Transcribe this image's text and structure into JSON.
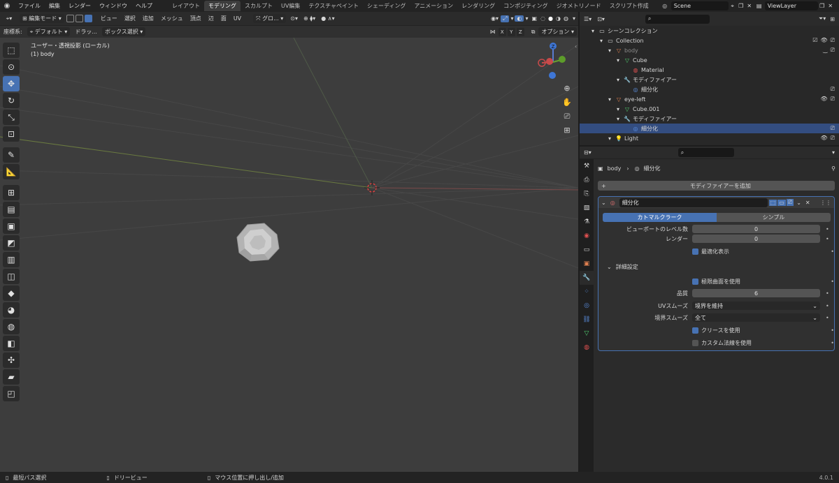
{
  "topbar": {
    "menus": [
      "ファイル",
      "編集",
      "レンダー",
      "ウィンドウ",
      "ヘルプ"
    ],
    "workspaces": [
      "レイアウト",
      "モデリング",
      "スカルプト",
      "UV編集",
      "テクスチャペイント",
      "シェーディング",
      "アニメーション",
      "レンダリング",
      "コンポジティング",
      "ジオメトリノード",
      "スクリプト作成"
    ],
    "active_workspace": "モデリング",
    "scene": "Scene",
    "view_layer": "ViewLayer"
  },
  "viewport_header": {
    "mode": "編集モード",
    "menus": [
      "ビュー",
      "選択",
      "追加",
      "メッシュ",
      "頂点",
      "辺",
      "面",
      "UV"
    ],
    "orientation": "グロ..."
  },
  "viewport_header2": {
    "coord_label": "座標系:",
    "coord_value": "デフォルト",
    "drag_label": "ドラッ...",
    "select_mode": "ボックス選択",
    "options": "オプション",
    "axes": [
      "X",
      "Y",
      "Z"
    ]
  },
  "viewport": {
    "view_name": "ユーザー・透視投影 (ローカル)",
    "object_name": "(1) body",
    "gizmo_z": "Z"
  },
  "outliner": {
    "rows": [
      {
        "label": "シーンコレクション",
        "indent": 0,
        "icon": "collection-icon"
      },
      {
        "label": "Collection",
        "indent": 1,
        "icon": "collection-icon"
      },
      {
        "label": "body",
        "indent": 2,
        "icon": "mesh-object-icon",
        "dim": true
      },
      {
        "label": "Cube",
        "indent": 3,
        "icon": "mesh-data-icon"
      },
      {
        "label": "Material",
        "indent": 4,
        "icon": "material-icon"
      },
      {
        "label": "モディファイアー",
        "indent": 3,
        "icon": "wrench-icon"
      },
      {
        "label": "細分化",
        "indent": 4,
        "icon": "subdivision-icon"
      },
      {
        "label": "eye-left",
        "indent": 2,
        "icon": "mesh-object-icon"
      },
      {
        "label": "Cube.001",
        "indent": 3,
        "icon": "mesh-data-icon"
      },
      {
        "label": "モディファイアー",
        "indent": 3,
        "icon": "wrench-icon"
      },
      {
        "label": "細分化",
        "indent": 4,
        "icon": "subdivision-icon",
        "selected": true
      },
      {
        "label": "Light",
        "indent": 2,
        "icon": "light-icon"
      }
    ]
  },
  "properties": {
    "breadcrumb_object": "body",
    "breadcrumb_modifier": "細分化",
    "add_modifier": "モディファイアーを追加",
    "modifier_name": "細分化",
    "tab_catmull": "カトマルクラーク",
    "tab_simple": "シンプル",
    "viewport_levels_label": "ビューポートのレベル数",
    "viewport_levels_value": "0",
    "render_label": "レンダー",
    "render_value": "0",
    "optimal_display": "最適化表示",
    "advanced": "詳細設定",
    "use_limit_surface": "極限曲面を使用",
    "quality_label": "品質",
    "quality_value": "6",
    "uv_smooth_label": "UVスムーズ",
    "uv_smooth_value": "境界を維持",
    "boundary_smooth_label": "境界スムーズ",
    "boundary_smooth_value": "全て",
    "use_crease": "クリースを使用",
    "use_custom_normals": "カスタム法線を使用"
  },
  "status": {
    "left": "最短パス選択",
    "middle": "ドリービュー",
    "right": "マウス位置に押し出し/追加",
    "version": "4.0.1"
  },
  "colors": {
    "accent": "#4772b3",
    "selection": "#334d80",
    "viewport_bg": "#3d3d3d"
  }
}
